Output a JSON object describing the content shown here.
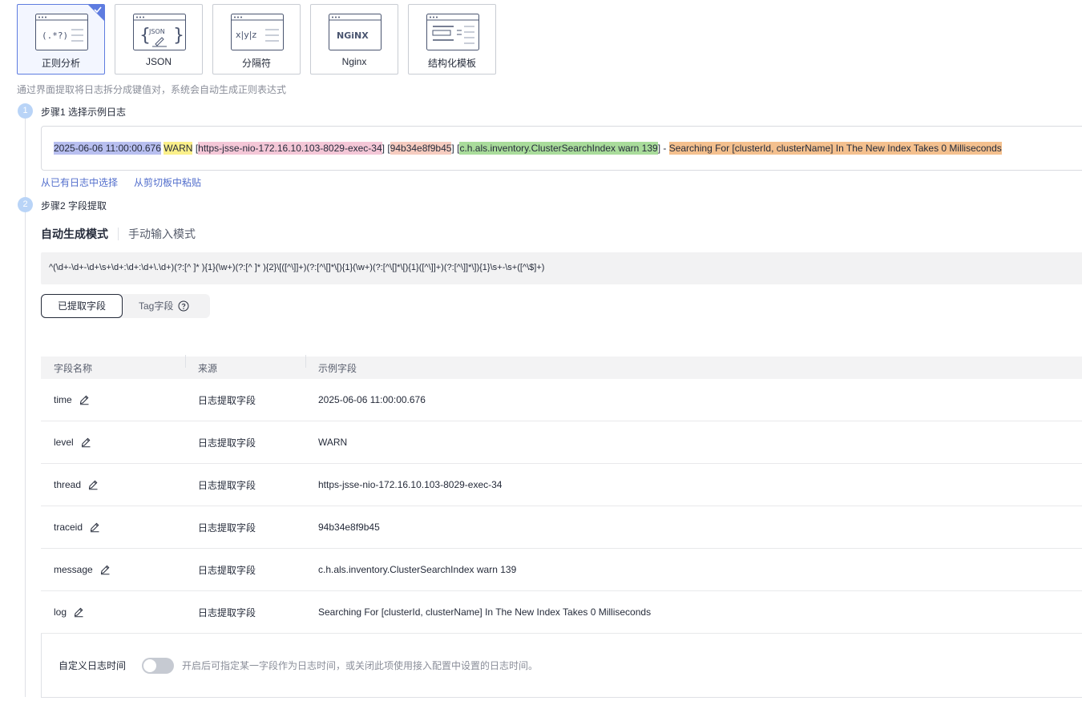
{
  "templates": [
    {
      "label": "正则分析",
      "illus_text": "(.*?)",
      "selected": true
    },
    {
      "label": "JSON",
      "illus_text": "{JSON}",
      "selected": false
    },
    {
      "label": "分隔符",
      "illus_text": "x|y|z",
      "selected": false
    },
    {
      "label": "Nginx",
      "illus_text": "NGiNX",
      "selected": false
    },
    {
      "label": "结构化模板",
      "illus_text": "",
      "selected": false
    }
  ],
  "description": "通过界面提取将日志拆分成键值对，系统会自动生成正则表达式",
  "step1": {
    "number": "1",
    "title": "步骤1 选择示例日志",
    "log_parts": {
      "time": "2025-06-06 11:00:00.676",
      "level": "WARN",
      "thread": "https-jsse-nio-172.16.10.103-8029-exec-34",
      "traceid": "94b34e8f9b45",
      "message": "c.h.als.inventory.ClusterSearchIndex warn 139",
      "log": "Searching For [clusterId, clusterName] In The New Index Takes 0 Milliseconds"
    },
    "link_existing": "从已有日志中选择",
    "link_clipboard": "从剪切板中粘贴"
  },
  "step2": {
    "number": "2",
    "title": "步骤2 字段提取",
    "mode_auto": "自动生成模式",
    "mode_manual": "手动输入模式",
    "regex": "^(\\d+-\\d+-\\d+\\s+\\d+:\\d+:\\d+\\.\\d+)(?:[^ ]* ){1}(\\w+)(?:[^ ]* ){2}\\[([^\\]]+)(?:[^\\[]*\\[){1}(\\w+)(?:[^\\[]*\\[){1}([^\\]]+)(?:[^\\]]*\\]){1}\\s+-\\s+([^\\$]+)",
    "tab_extracted": "已提取字段",
    "tab_tag": "Tag字段"
  },
  "table": {
    "headers": [
      "字段名称",
      "来源",
      "示例字段"
    ],
    "rows": [
      {
        "name": "time",
        "source": "日志提取字段",
        "example": "2025-06-06 11:00:00.676"
      },
      {
        "name": "level",
        "source": "日志提取字段",
        "example": "WARN"
      },
      {
        "name": "thread",
        "source": "日志提取字段",
        "example": "https-jsse-nio-172.16.10.103-8029-exec-34"
      },
      {
        "name": "traceid",
        "source": "日志提取字段",
        "example": "94b34e8f9b45"
      },
      {
        "name": "message",
        "source": "日志提取字段",
        "example": "c.h.als.inventory.ClusterSearchIndex warn 139"
      },
      {
        "name": "log",
        "source": "日志提取字段",
        "example": "Searching For [clusterId, clusterName] In The New Index Takes 0 Milliseconds"
      }
    ]
  },
  "custom_time": {
    "label": "自定义日志时间",
    "enabled": false,
    "hint": "开启后可指定某一字段作为日志时间，或关闭此项使用接入配置中设置的日志时间。"
  },
  "colors": {
    "accent": "#5e7ce0",
    "link": "#526ecc",
    "hl_time": "#b8bff0",
    "hl_level": "#fbf08a",
    "hl_thread": "#f4c7d7",
    "hl_trace": "#f6ccc0",
    "hl_msg": "#a9dc9b",
    "hl_log": "#f4c08e"
  },
  "icons": [
    "check-icon",
    "edit-icon",
    "help-circle-icon"
  ]
}
